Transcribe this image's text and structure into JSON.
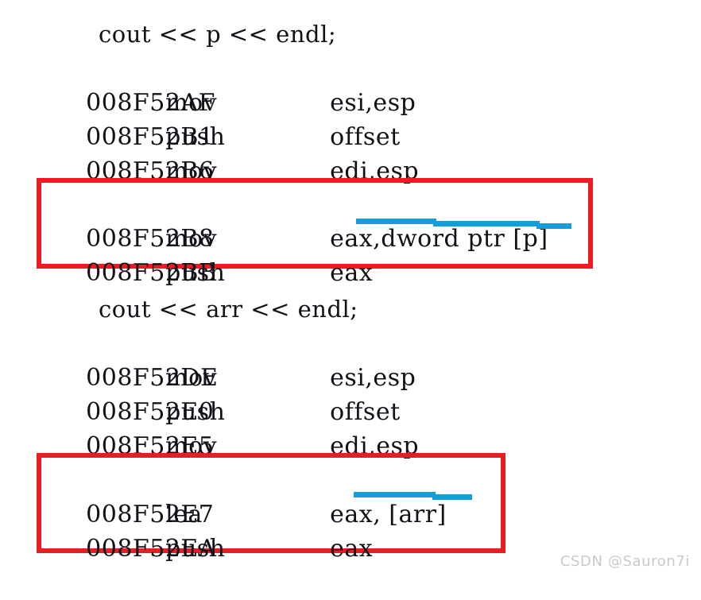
{
  "page": {
    "background_color": "#ffffff",
    "text_color": "#111118",
    "highlight_box_color": "#ed1c24",
    "underline_color": "#139ddb"
  },
  "listing": {
    "blocks": [
      {
        "id": "block-cout-p",
        "source_line": "cout << p << endl;",
        "instructions": [
          {
            "address": "008F52AF",
            "mnemonic": "mov",
            "operands": "esi,esp"
          },
          {
            "address": "008F52B1",
            "mnemonic": "push",
            "operands": "offset"
          },
          {
            "address": "008F52B6",
            "mnemonic": "mov",
            "operands": "edi,esp"
          }
        ],
        "highlighted_instructions": [
          {
            "address": "008F52B8",
            "mnemonic": "mov",
            "operands": "eax,dword ptr [p]"
          },
          {
            "address": "008F52BB",
            "mnemonic": "push",
            "operands": "eax"
          }
        ]
      },
      {
        "id": "block-cout-arr",
        "source_line": "cout << arr << endl;",
        "instructions": [
          {
            "address": "008F52DE",
            "mnemonic": "mov",
            "operands": "esi,esp"
          },
          {
            "address": "008F52E0",
            "mnemonic": "push",
            "operands": "offset"
          },
          {
            "address": "008F52E5",
            "mnemonic": "mov",
            "operands": "edi,esp"
          }
        ],
        "highlighted_instructions": [
          {
            "address": "008F52E7",
            "mnemonic": "lea",
            "operands": "eax, [arr]"
          },
          {
            "address": "008F52EA",
            "mnemonic": "push",
            "operands": "eax"
          }
        ]
      }
    ]
  },
  "annotations": {
    "red_boxes": [
      {
        "name": "highlight-box-mov-eax-dword-ptr-p"
      },
      {
        "name": "highlight-box-lea-eax-arr"
      }
    ],
    "blue_underlines": [
      {
        "name": "underline-eax-dword-ptr-p"
      },
      {
        "name": "underline-eax-arr"
      }
    ]
  },
  "watermark": {
    "text": "CSDN @Sauron7i"
  }
}
